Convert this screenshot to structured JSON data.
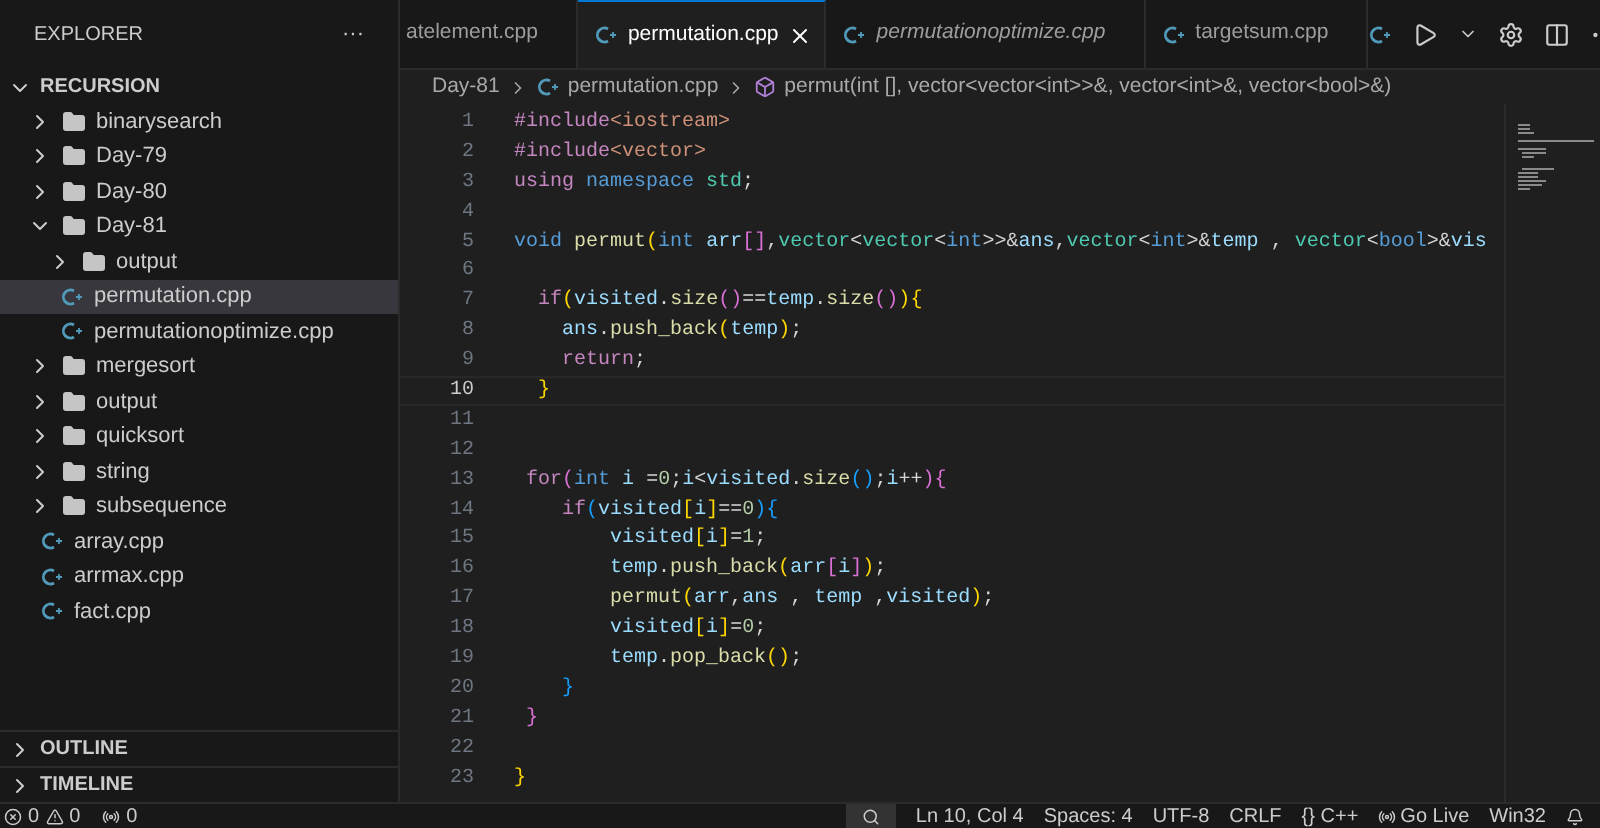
{
  "sidebar": {
    "title": "EXPLORER",
    "more": "···",
    "root": {
      "label": "RECURSION",
      "expanded": true,
      "children": [
        {
          "kind": "folder",
          "label": "binarysearch",
          "expanded": false,
          "selected": false
        },
        {
          "kind": "folder",
          "label": "Day-79",
          "expanded": false,
          "selected": false
        },
        {
          "kind": "folder",
          "label": "Day-80",
          "expanded": false,
          "selected": false
        },
        {
          "kind": "folder",
          "label": "Day-81",
          "expanded": true,
          "selected": false,
          "children": [
            {
              "kind": "folder",
              "label": "output",
              "expanded": false,
              "selected": false
            },
            {
              "kind": "file",
              "label": "permutation.cpp",
              "selected": true
            },
            {
              "kind": "file",
              "label": "permutationoptimize.cpp",
              "selected": false
            }
          ]
        },
        {
          "kind": "folder",
          "label": "mergesort",
          "expanded": false,
          "selected": false
        },
        {
          "kind": "folder",
          "label": "output",
          "expanded": false,
          "selected": false
        },
        {
          "kind": "folder",
          "label": "quicksort",
          "expanded": false,
          "selected": false
        },
        {
          "kind": "folder",
          "label": "string",
          "expanded": false,
          "selected": false
        },
        {
          "kind": "folder",
          "label": "subsequence",
          "expanded": false,
          "selected": false
        },
        {
          "kind": "file",
          "label": "array.cpp",
          "selected": false
        },
        {
          "kind": "file",
          "label": "arrmax.cpp",
          "selected": false
        },
        {
          "kind": "file",
          "label": "fact.cpp",
          "selected": false
        }
      ]
    },
    "sections": [
      {
        "label": "OUTLINE",
        "expanded": false
      },
      {
        "label": "TIMELINE",
        "expanded": false
      }
    ]
  },
  "tabs": [
    {
      "label": "atelement.cpp",
      "selected": false,
      "preview": false,
      "file_icon": false
    },
    {
      "label": "permutation.cpp",
      "selected": true,
      "preview": false,
      "file_icon": true
    },
    {
      "label": "permutationoptimize.cpp",
      "selected": false,
      "preview": true,
      "file_icon": true
    },
    {
      "label": "targetsum.cpp",
      "selected": false,
      "preview": false,
      "file_icon": true
    }
  ],
  "breadcrumb": [
    "Day-81",
    "permutation.cpp",
    "permut(int [], vector<vector<int>>&, vector<int>&, vector<bool>&)"
  ],
  "editor": {
    "lines": [
      {
        "number": "1",
        "current": false,
        "tokens": [
          {
            "kind": "pre",
            "text": "#include"
          },
          {
            "kind": "str",
            "text": "<iostream>"
          }
        ]
      },
      {
        "number": "2",
        "current": false,
        "tokens": [
          {
            "kind": "pre",
            "text": "#include"
          },
          {
            "kind": "str",
            "text": "<vector>"
          }
        ]
      },
      {
        "number": "3",
        "current": false,
        "tokens": [
          {
            "kind": "ctl",
            "text": "using"
          },
          {
            "kind": "kw",
            "text": " namespace"
          },
          {
            "kind": "ty",
            "text": " std"
          },
          {
            "kind": "pl",
            "text": ";"
          }
        ]
      },
      {
        "number": "4",
        "current": false
      },
      {
        "number": "5",
        "current": false,
        "tokens": [
          {
            "kind": "kw",
            "text": "void"
          },
          {
            "kind": "fn",
            "text": " permut"
          },
          {
            "kind": "b1",
            "text": "("
          },
          {
            "kind": "kw",
            "text": "int"
          },
          {
            "kind": "var",
            "text": " arr"
          },
          {
            "kind": "b2",
            "text": "[]"
          },
          {
            "kind": "pl",
            "text": ","
          },
          {
            "kind": "ty",
            "text": "vector"
          },
          {
            "kind": "pl",
            "text": "<"
          },
          {
            "kind": "ty",
            "text": "vector"
          },
          {
            "kind": "pl",
            "text": "<"
          },
          {
            "kind": "kw",
            "text": "int"
          },
          {
            "kind": "pl",
            "text": ">>&"
          },
          {
            "kind": "var",
            "text": "ans"
          },
          {
            "kind": "pl",
            "text": ","
          },
          {
            "kind": "ty",
            "text": "vector"
          },
          {
            "kind": "pl",
            "text": "<"
          },
          {
            "kind": "kw",
            "text": "int"
          },
          {
            "kind": "pl",
            "text": ">&"
          },
          {
            "kind": "var",
            "text": "temp"
          },
          {
            "kind": "pl",
            "text": " , "
          },
          {
            "kind": "ty",
            "text": "vector"
          },
          {
            "kind": "pl",
            "text": "<"
          },
          {
            "kind": "kw",
            "text": "bool"
          },
          {
            "kind": "pl",
            "text": ">&"
          },
          {
            "kind": "var",
            "text": "vis"
          }
        ]
      },
      {
        "number": "6",
        "current": false
      },
      {
        "number": "7",
        "current": false,
        "tokens": [
          {
            "kind": "ctl",
            "text": "  if"
          },
          {
            "kind": "b1",
            "text": "("
          },
          {
            "kind": "var",
            "text": "visited"
          },
          {
            "kind": "pl",
            "text": "."
          },
          {
            "kind": "fn",
            "text": "size"
          },
          {
            "kind": "b2",
            "text": "()"
          },
          {
            "kind": "pl",
            "text": "=="
          },
          {
            "kind": "var",
            "text": "temp"
          },
          {
            "kind": "pl",
            "text": "."
          },
          {
            "kind": "fn",
            "text": "size"
          },
          {
            "kind": "b2",
            "text": "()"
          },
          {
            "kind": "b1",
            "text": ")"
          },
          {
            "kind": "b1",
            "text": "{"
          }
        ]
      },
      {
        "number": "8",
        "current": false,
        "tokens": [
          {
            "kind": "var",
            "text": "    ans"
          },
          {
            "kind": "pl",
            "text": "."
          },
          {
            "kind": "fn",
            "text": "push_back"
          },
          {
            "kind": "b1",
            "text": "("
          },
          {
            "kind": "var",
            "text": "temp"
          },
          {
            "kind": "b1",
            "text": ")"
          },
          {
            "kind": "pl",
            "text": ";"
          }
        ]
      },
      {
        "number": "9",
        "current": false,
        "tokens": [
          {
            "kind": "ctl",
            "text": "    return"
          },
          {
            "kind": "pl",
            "text": ";"
          }
        ]
      },
      {
        "number": "10",
        "current": true,
        "tokens": [
          {
            "kind": "b1",
            "text": "  }"
          }
        ]
      },
      {
        "number": "11",
        "current": false
      },
      {
        "number": "12",
        "current": false
      },
      {
        "number": "13",
        "current": false,
        "tokens": [
          {
            "kind": "ctl",
            "text": " for"
          },
          {
            "kind": "b2",
            "text": "("
          },
          {
            "kind": "kw",
            "text": "int"
          },
          {
            "kind": "var",
            "text": " i"
          },
          {
            "kind": "pl",
            "text": " ="
          },
          {
            "kind": "num",
            "text": "0"
          },
          {
            "kind": "pl",
            "text": ";"
          },
          {
            "kind": "var",
            "text": "i"
          },
          {
            "kind": "pl",
            "text": "<"
          },
          {
            "kind": "var",
            "text": "visited"
          },
          {
            "kind": "pl",
            "text": "."
          },
          {
            "kind": "fn",
            "text": "size"
          },
          {
            "kind": "b3",
            "text": "()"
          },
          {
            "kind": "pl",
            "text": ";"
          },
          {
            "kind": "var",
            "text": "i"
          },
          {
            "kind": "pl",
            "text": "++"
          },
          {
            "kind": "b2",
            "text": ")"
          },
          {
            "kind": "b2",
            "text": "{"
          }
        ]
      },
      {
        "number": "14",
        "current": false,
        "tokens": [
          {
            "kind": "ctl",
            "text": "    if"
          },
          {
            "kind": "b3",
            "text": "("
          },
          {
            "kind": "var",
            "text": "visited"
          },
          {
            "kind": "b1",
            "text": "["
          },
          {
            "kind": "var",
            "text": "i"
          },
          {
            "kind": "b1",
            "text": "]"
          },
          {
            "kind": "pl",
            "text": "=="
          },
          {
            "kind": "num",
            "text": "0"
          },
          {
            "kind": "b3",
            "text": ")"
          },
          {
            "kind": "b3",
            "text": "{"
          }
        ]
      },
      {
        "number": "15",
        "current": false,
        "tokens": [
          {
            "kind": "var",
            "text": "        visited"
          },
          {
            "kind": "b1",
            "text": "["
          },
          {
            "kind": "var",
            "text": "i"
          },
          {
            "kind": "b1",
            "text": "]"
          },
          {
            "kind": "pl",
            "text": "="
          },
          {
            "kind": "num",
            "text": "1"
          },
          {
            "kind": "pl",
            "text": ";"
          }
        ]
      },
      {
        "number": "16",
        "current": false,
        "tokens": [
          {
            "kind": "var",
            "text": "        temp"
          },
          {
            "kind": "pl",
            "text": "."
          },
          {
            "kind": "fn",
            "text": "push_back"
          },
          {
            "kind": "b1",
            "text": "("
          },
          {
            "kind": "var",
            "text": "arr"
          },
          {
            "kind": "b2",
            "text": "["
          },
          {
            "kind": "var",
            "text": "i"
          },
          {
            "kind": "b2",
            "text": "]"
          },
          {
            "kind": "b1",
            "text": ")"
          },
          {
            "kind": "pl",
            "text": ";"
          }
        ]
      },
      {
        "number": "17",
        "current": false,
        "tokens": [
          {
            "kind": "fn",
            "text": "        permut"
          },
          {
            "kind": "b1",
            "text": "("
          },
          {
            "kind": "var",
            "text": "arr"
          },
          {
            "kind": "pl",
            "text": ","
          },
          {
            "kind": "var",
            "text": "ans"
          },
          {
            "kind": "pl",
            "text": " , "
          },
          {
            "kind": "var",
            "text": "temp"
          },
          {
            "kind": "pl",
            "text": " ,"
          },
          {
            "kind": "var",
            "text": "visited"
          },
          {
            "kind": "b1",
            "text": ")"
          },
          {
            "kind": "pl",
            "text": ";"
          }
        ]
      },
      {
        "number": "18",
        "current": false,
        "tokens": [
          {
            "kind": "var",
            "text": "        visited"
          },
          {
            "kind": "b1",
            "text": "["
          },
          {
            "kind": "var",
            "text": "i"
          },
          {
            "kind": "b1",
            "text": "]"
          },
          {
            "kind": "pl",
            "text": "="
          },
          {
            "kind": "num",
            "text": "0"
          },
          {
            "kind": "pl",
            "text": ";"
          }
        ]
      },
      {
        "number": "19",
        "current": false,
        "tokens": [
          {
            "kind": "var",
            "text": "        temp"
          },
          {
            "kind": "pl",
            "text": "."
          },
          {
            "kind": "fn",
            "text": "pop_back"
          },
          {
            "kind": "b1",
            "text": "()"
          },
          {
            "kind": "pl",
            "text": ";"
          }
        ]
      },
      {
        "number": "20",
        "current": false,
        "tokens": [
          {
            "kind": "b3",
            "text": "    }"
          }
        ]
      },
      {
        "number": "21",
        "current": false,
        "tokens": [
          {
            "kind": "b2",
            "text": " }"
          }
        ]
      },
      {
        "number": "22",
        "current": false
      },
      {
        "number": "23",
        "current": false,
        "tokens": [
          {
            "kind": "b1",
            "text": "}"
          }
        ]
      }
    ]
  },
  "status_bar": {
    "errors": "0",
    "warnings": "0",
    "ports": "0",
    "position": "Ln 10, Col 4",
    "spaces": "Spaces: 4",
    "encoding": "UTF-8",
    "eol": "CRLF",
    "language": "C++",
    "language_icon": "{}",
    "live": "Go Live",
    "platform": "Win32"
  }
}
